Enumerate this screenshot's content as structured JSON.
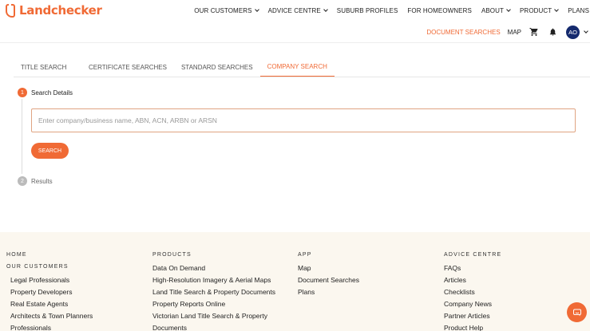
{
  "brand": {
    "name": "Landchecker",
    "color": "#f06a35"
  },
  "nav": {
    "items": [
      {
        "label": "OUR CUSTOMERS",
        "dropdown": true
      },
      {
        "label": "ADVICE CENTRE",
        "dropdown": true
      },
      {
        "label": "SUBURB PROFILES",
        "dropdown": false
      },
      {
        "label": "FOR HOMEOWNERS",
        "dropdown": false
      },
      {
        "label": "ABOUT",
        "dropdown": true
      },
      {
        "label": "PRODUCT",
        "dropdown": true
      },
      {
        "label": "PLANS",
        "dropdown": false
      }
    ]
  },
  "subnav": {
    "document_searches": "DOCUMENT SEARCHES",
    "map": "MAP",
    "cart_icon": "cart-icon",
    "bell_icon": "bell-icon",
    "avatar": "AO"
  },
  "tabs": [
    {
      "label": "TITLE SEARCH",
      "active": false
    },
    {
      "label": "CERTIFICATE SEARCHES",
      "active": false
    },
    {
      "label": "STANDARD SEARCHES",
      "active": false
    },
    {
      "label": "COMPANY SEARCH",
      "active": true
    }
  ],
  "steps": [
    {
      "num": "1",
      "label": "Search Details"
    },
    {
      "num": "2",
      "label": "Results"
    }
  ],
  "search": {
    "placeholder": "Enter company/business name, ABN, ACN, ARBN or ARSN",
    "value": "",
    "button": "SEARCH"
  },
  "footer": {
    "columns": [
      {
        "heading": "HOME",
        "subheading": "OUR CUSTOMERS",
        "items": [
          "Legal Professionals",
          "Property Developers",
          "Real Estate Agents",
          "Architects & Town Planners",
          "Professionals"
        ]
      },
      {
        "heading": "PRODUCTS",
        "items": [
          "Data On Demand",
          "High-Resolution Imagery & Aerial Maps",
          "Land Title Search & Property Documents",
          "Property Reports Online",
          "Victorian Land Title Search & Property",
          "Documents"
        ]
      },
      {
        "heading": "APP",
        "items": [
          "Map",
          "Document Searches",
          "Plans"
        ]
      },
      {
        "heading": "ADVICE CENTRE",
        "items": [
          "FAQs",
          "Articles",
          "Checklists",
          "Company News",
          "Partner Articles",
          "Product Help"
        ]
      }
    ],
    "chat_icon": "chat-icon"
  }
}
